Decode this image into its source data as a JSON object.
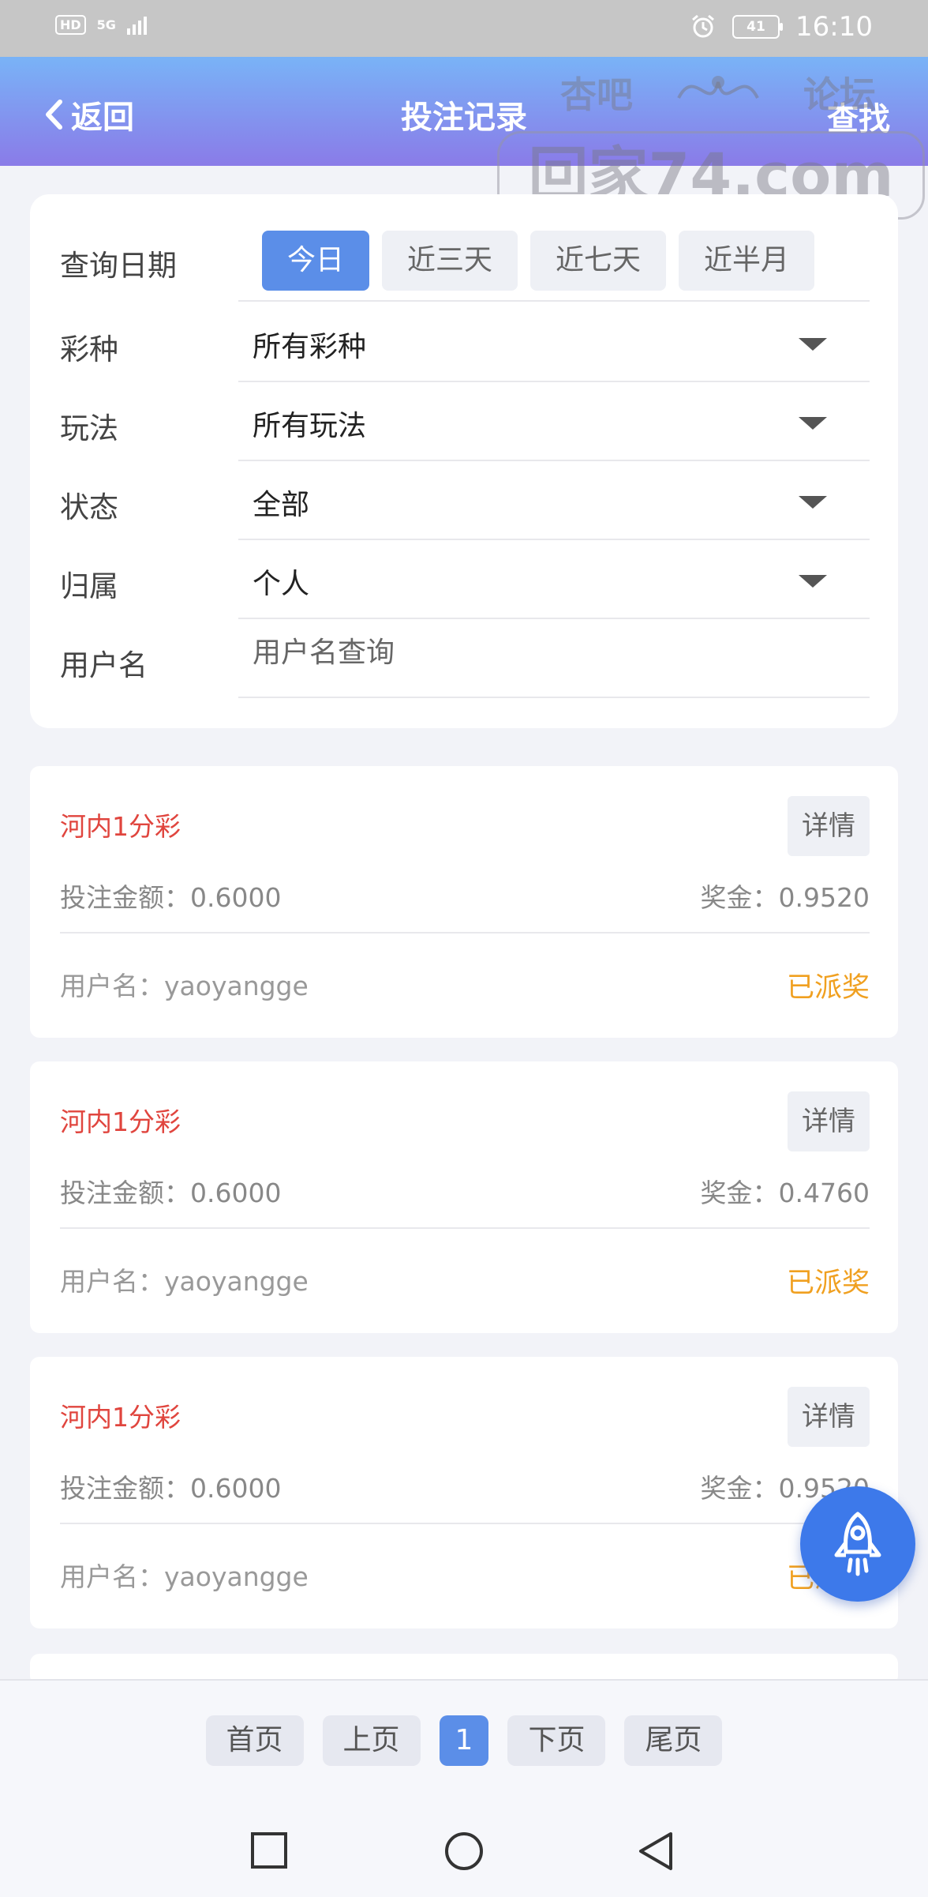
{
  "status_bar": {
    "hd": "HD",
    "network": "5G",
    "battery": "41",
    "time": "16:10"
  },
  "header": {
    "back_label": "返回",
    "title": "投注记录",
    "search_label": "查找"
  },
  "watermark": {
    "top_left": "杏吧",
    "top_right": "论坛",
    "domain": "回家74.com"
  },
  "filters": {
    "date_label": "查询日期",
    "date_options": [
      "今日",
      "近三天",
      "近七天",
      "近半月"
    ],
    "date_selected": "今日",
    "lottery_label": "彩种",
    "lottery_value": "所有彩种",
    "play_label": "玩法",
    "play_value": "所有玩法",
    "status_label": "状态",
    "status_value": "全部",
    "owner_label": "归属",
    "owner_value": "个人",
    "username_label": "用户名",
    "username_placeholder": "用户名查询"
  },
  "records": [
    {
      "lottery": "河内1分彩",
      "detail_label": "详情",
      "amount_text": "投注金额：0.6000",
      "prize_text": "奖金：0.9520",
      "user_text": "用户名：yaoyangge",
      "status": "已派奖"
    },
    {
      "lottery": "河内1分彩",
      "detail_label": "详情",
      "amount_text": "投注金额：0.6000",
      "prize_text": "奖金：0.4760",
      "user_text": "用户名：yaoyangge",
      "status": "已派奖"
    },
    {
      "lottery": "河内1分彩",
      "detail_label": "详情",
      "amount_text": "投注金额：0.6000",
      "prize_text": "奖金：0.9520",
      "user_text": "用户名：yaoyangge",
      "status": "已派奖"
    }
  ],
  "pagination": {
    "first": "首页",
    "prev": "上页",
    "current": "1",
    "next": "下页",
    "last": "尾页"
  },
  "icons": {
    "fab": "rocket-icon",
    "nav": [
      "recents-square-icon",
      "home-circle-icon",
      "back-triangle-icon"
    ]
  },
  "colors": {
    "header_gradient_top": "#79b3f7",
    "header_gradient_bottom": "#8a7be8",
    "accent": "#5b8ee8",
    "lottery_red": "#e0453e",
    "status_orange": "#f0a020",
    "fab_blue": "#3d79ea"
  }
}
